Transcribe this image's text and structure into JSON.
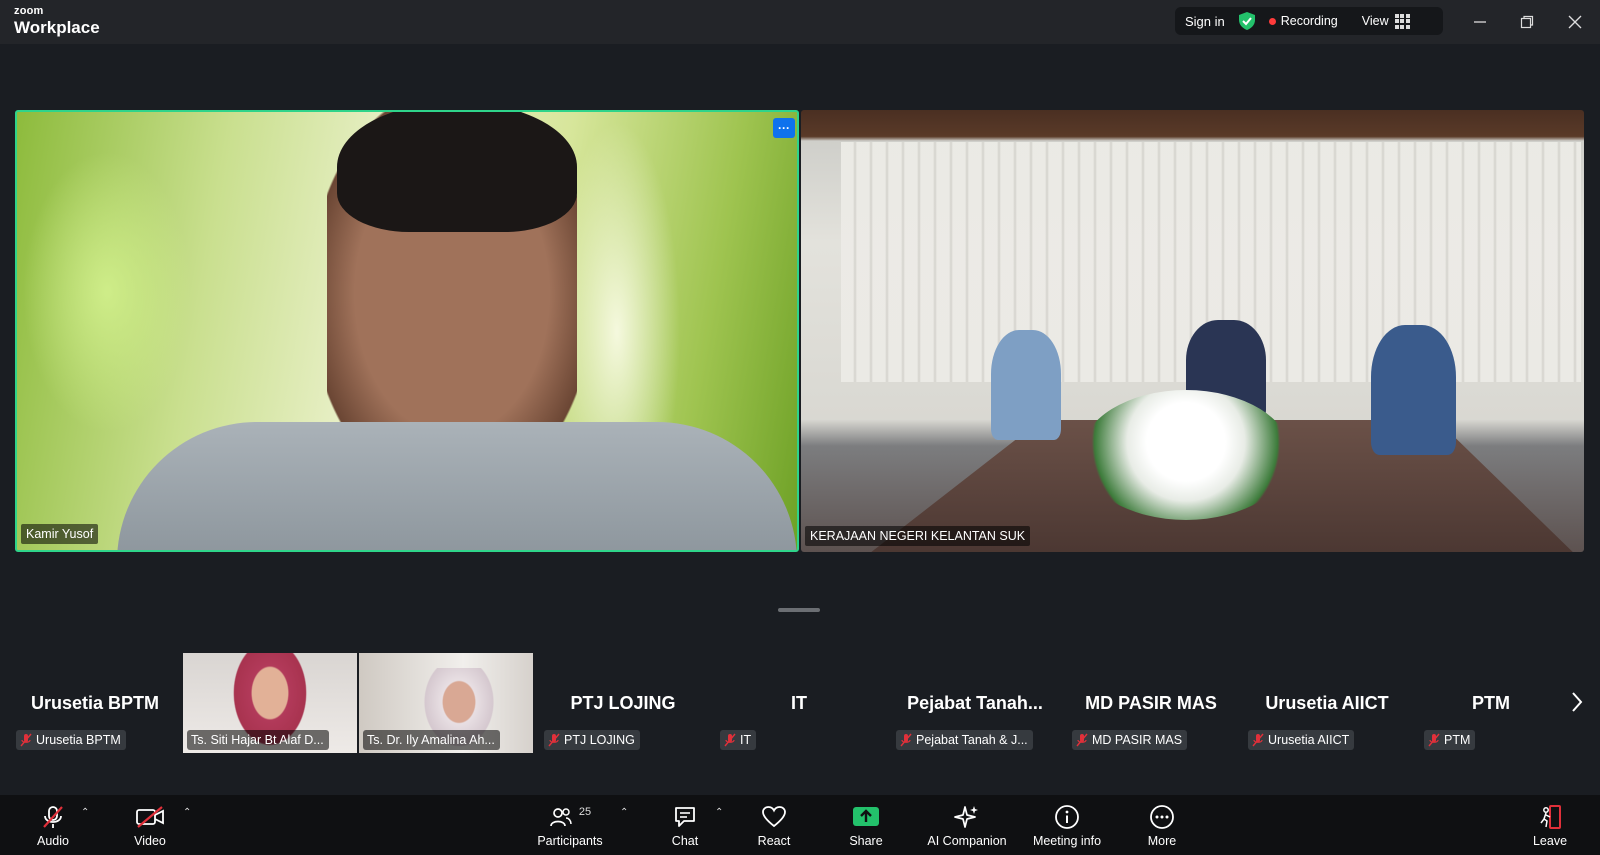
{
  "app": {
    "brand_small": "zoom",
    "brand_big": "Workplace"
  },
  "titlebar": {
    "sign_in": "Sign in",
    "recording": "Recording",
    "view": "View"
  },
  "colors": {
    "active_speaker_border": "#2fd48a",
    "recording_dot": "#ff3b3b",
    "share_green": "#23c16b",
    "accent_blue": "#0e72ed",
    "mute_red": "#e0303a"
  },
  "main_videos": [
    {
      "name": "Kamir Yusof",
      "more": "···"
    },
    {
      "name": "KERAJAAN NEGERI KELANTAN SUK"
    }
  ],
  "gallery": [
    {
      "display_name": "Urusetia BPTM",
      "label": "Urusetia BPTM",
      "video": false
    },
    {
      "display_name": "",
      "label": "Ts. Siti Hajar Bt Alaf D...",
      "video": true
    },
    {
      "display_name": "",
      "label": "Ts. Dr. Ily Amalina Ah...",
      "video": true
    },
    {
      "display_name": "PTJ LOJING",
      "label": "PTJ LOJING",
      "video": false
    },
    {
      "display_name": "IT",
      "label": "IT",
      "video": false
    },
    {
      "display_name": "Pejabat  Tanah...",
      "label": "Pejabat Tanah & J...",
      "video": false
    },
    {
      "display_name": "MD PASIR MAS",
      "label": "MD PASIR MAS",
      "video": false
    },
    {
      "display_name": "Urusetia AIICT",
      "label": "Urusetia AIICT",
      "video": false
    },
    {
      "display_name": "PTM",
      "label": "PTM",
      "video": false
    }
  ],
  "toolbar": {
    "audio": "Audio",
    "video": "Video",
    "participants": "Participants",
    "participants_count": "25",
    "chat": "Chat",
    "react": "React",
    "share": "Share",
    "ai_companion": "AI Companion",
    "meeting_info": "Meeting info",
    "more": "More",
    "leave": "Leave"
  }
}
